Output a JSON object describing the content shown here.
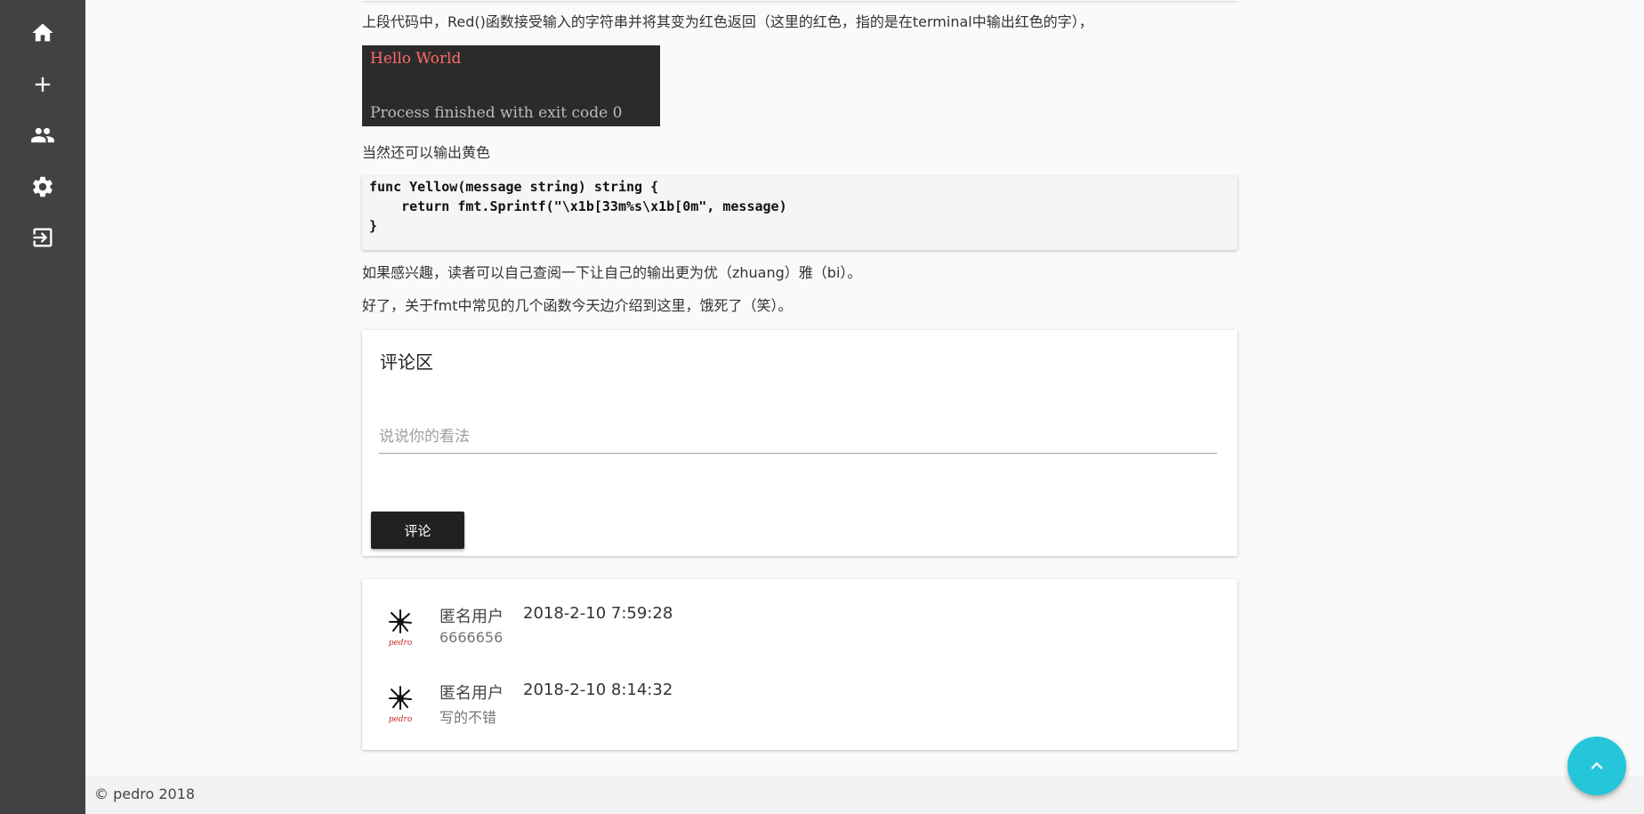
{
  "sidebar": {
    "items": [
      {
        "icon": "home-icon",
        "label": "home"
      },
      {
        "icon": "add-icon",
        "label": "add"
      },
      {
        "icon": "people-icon",
        "label": "people"
      },
      {
        "icon": "settings-icon",
        "label": "settings"
      },
      {
        "icon": "logout-icon",
        "label": "logout"
      }
    ]
  },
  "article": {
    "para_red": "上段代码中，Red()函数接受输入的字符串并将其变为红色返回（这里的红色，指的是在terminal中输出红色的字），",
    "terminal": {
      "line1": "Hello World",
      "line2": "Process finished with exit code 0",
      "line1_color": "#ff6b68",
      "line2_color": "#bbbbbb"
    },
    "para_yellow": "当然还可以输出黄色",
    "code": "func Yellow(message string) string {\n    return fmt.Sprintf(\"\\x1b[33m%s\\x1b[0m\", message)\n}",
    "para_interest": "如果感兴趣，读者可以自己查阅一下让自己的输出更为优（zhuang）雅（bi）。",
    "para_end": "好了，关于fmt中常见的几个函数今天边介绍到这里，饿死了（笑）。"
  },
  "comment_form": {
    "title": "评论区",
    "placeholder": "说说你的看法",
    "submit_label": "评论"
  },
  "comments": [
    {
      "author": "匿名用户",
      "time": "2018-2-10 7:59:28",
      "text": "6666656"
    },
    {
      "author": "匿名用户",
      "time": "2018-2-10 8:14:32",
      "text": "写的不错"
    }
  ],
  "avatar_caption": "pedro",
  "footer": {
    "text": "© pedro 2018"
  },
  "colors": {
    "sidebar": "#424242",
    "fab": "#26c6da",
    "button": "#212121"
  }
}
